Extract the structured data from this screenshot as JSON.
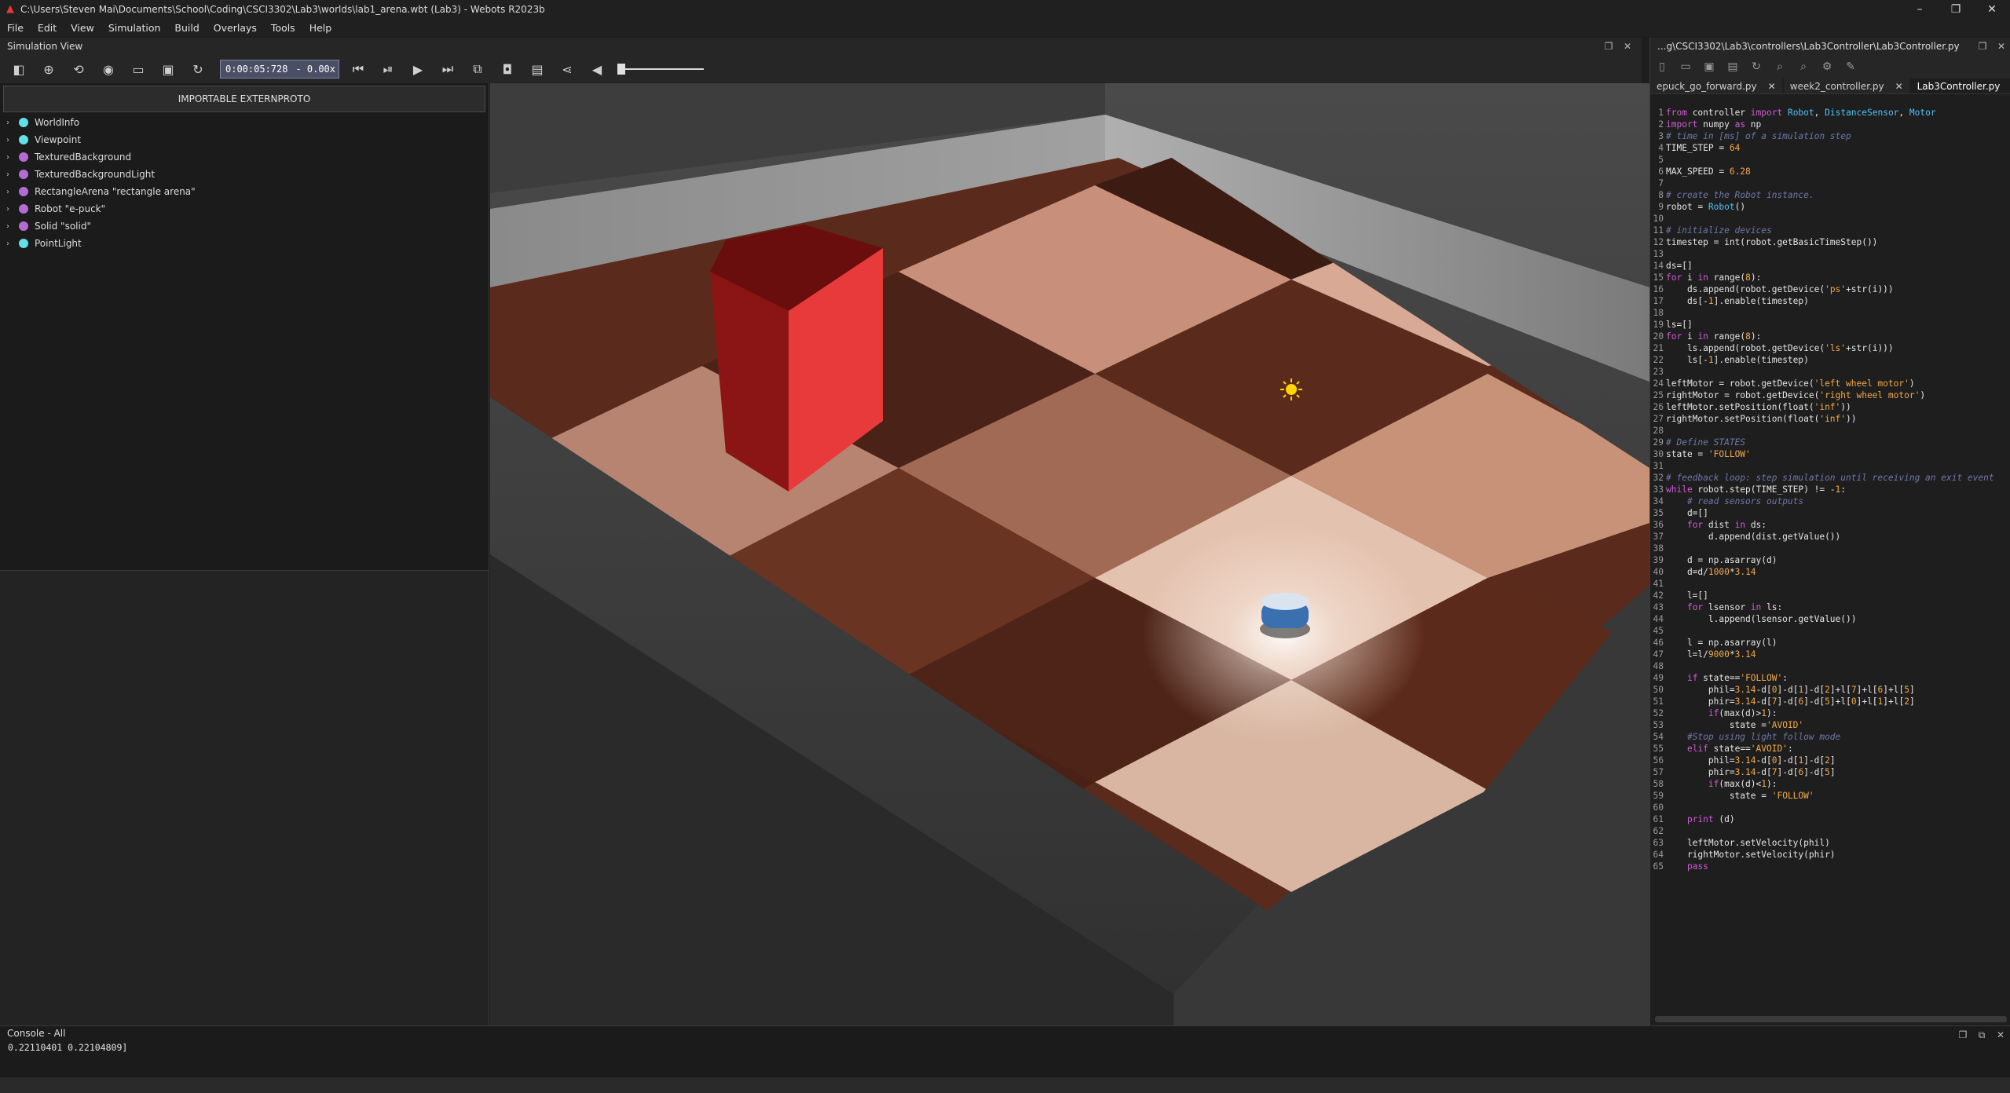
{
  "window": {
    "title": "C:\\Users\\Steven Mai\\Documents\\School\\Coding\\CSCI3302\\Lab3\\worlds\\lab1_arena.wbt (Lab3) - Webots R2023b",
    "controls": [
      "–",
      "❐",
      "✕"
    ]
  },
  "menu": [
    "File",
    "Edit",
    "View",
    "Simulation",
    "Build",
    "Overlays",
    "Tools",
    "Help"
  ],
  "simulation_view": {
    "title": "Simulation View"
  },
  "toolbar": {
    "time": "0:00:05:728",
    "separator": "-",
    "speed": "0.00x"
  },
  "scene_tree": {
    "externproto_label": "IMPORTABLE EXTERNPROTO",
    "nodes": [
      {
        "label": "WorldInfo",
        "color": "#62e0e8"
      },
      {
        "label": "Viewpoint",
        "color": "#62e0e8"
      },
      {
        "label": "TexturedBackground",
        "color": "#b56bd4"
      },
      {
        "label": "TexturedBackgroundLight",
        "color": "#b56bd4"
      },
      {
        "label": "RectangleArena \"rectangle arena\"",
        "color": "#b56bd4"
      },
      {
        "label": "Robot \"e-puck\"",
        "color": "#b56bd4"
      },
      {
        "label": "Solid \"solid\"",
        "color": "#b56bd4"
      },
      {
        "label": "PointLight",
        "color": "#62e0e8"
      }
    ]
  },
  "editor": {
    "path": "...g\\CSCI3302\\Lab3\\controllers\\Lab3Controller\\Lab3Controller.py",
    "tabs": [
      {
        "label": "epuck_go_forward.py",
        "active": false
      },
      {
        "label": "week2_controller.py",
        "active": false
      },
      {
        "label": "Lab3Controller.py",
        "active": true
      }
    ],
    "code": [
      "from controller import Robot, DistanceSensor, Motor",
      "import numpy as np",
      "# time in [ms] of a simulation step",
      "TIME_STEP = 64",
      "",
      "MAX_SPEED = 6.28",
      "",
      "# create the Robot instance.",
      "robot = Robot()",
      "",
      "# initialize devices",
      "timestep = int(robot.getBasicTimeStep())",
      "",
      "ds=[]",
      "for i in range(8):",
      "    ds.append(robot.getDevice('ps'+str(i)))",
      "    ds[-1].enable(timestep)",
      "",
      "ls=[]",
      "for i in range(8):",
      "    ls.append(robot.getDevice('ls'+str(i)))",
      "    ls[-1].enable(timestep)",
      "",
      "leftMotor = robot.getDevice('left wheel motor')",
      "rightMotor = robot.getDevice('right wheel motor')",
      "leftMotor.setPosition(float('inf'))",
      "rightMotor.setPosition(float('inf'))",
      "",
      "# Define STATES",
      "state = 'FOLLOW'",
      "",
      "# feedback loop: step simulation until receiving an exit event",
      "while robot.step(TIME_STEP) != -1:",
      "    # read sensors outputs",
      "    d=[]",
      "    for dist in ds:",
      "        d.append(dist.getValue())",
      "",
      "    d = np.asarray(d)",
      "    d=d/1000*3.14",
      "",
      "    l=[]",
      "    for lsensor in ls:",
      "        l.append(lsensor.getValue())",
      "",
      "    l = np.asarray(l)",
      "    l=l/9000*3.14",
      "",
      "    if state=='FOLLOW':",
      "        phil=3.14-d[0]-d[1]-d[2]+l[7]+l[6]+l[5]",
      "        phir=3.14-d[7]-d[6]-d[5]+l[0]+l[1]+l[2]",
      "        if(max(d)>1):",
      "            state ='AVOID'",
      "    #Stop using light follow mode",
      "    elif state=='AVOID':",
      "        phil=3.14-d[0]-d[1]-d[2]",
      "        phir=3.14-d[7]-d[6]-d[5]",
      "        if(max(d)<1):",
      "            state = 'FOLLOW'",
      "",
      "    print (d)",
      "",
      "    leftMotor.setVelocity(phil)",
      "    rightMotor.setVelocity(phir)",
      "    pass"
    ]
  },
  "console": {
    "title": "Console - All",
    "output": "0.22110401 0.22104809]"
  },
  "colors": {
    "cube": "#e03030",
    "light_tile": "#c8907a",
    "dark_tile": "#5a2a1c",
    "accent": "#4a4f66"
  }
}
